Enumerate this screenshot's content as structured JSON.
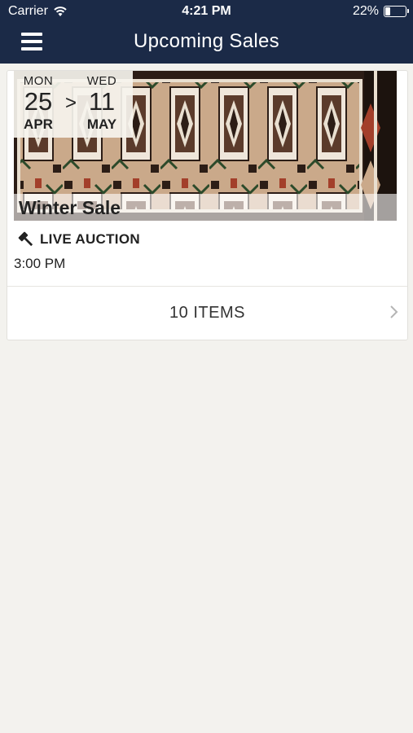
{
  "status_bar": {
    "carrier": "Carrier",
    "time": "4:21 PM",
    "battery": "22%",
    "battery_level": 0.22
  },
  "nav": {
    "title": "Upcoming Sales",
    "menu_icon": "hamburger-menu-icon"
  },
  "sale": {
    "start": {
      "dow": "MON",
      "day": "25",
      "month": "APR"
    },
    "separator": ">",
    "end": {
      "dow": "WED",
      "day": "11",
      "month": "MAY"
    },
    "title": "Winter Sale",
    "type": "LIVE AUCTION",
    "type_icon": "gavel-icon",
    "time": "3:00 PM",
    "items_label": "10 ITEMS"
  },
  "colors": {
    "nav_bg": "#1b2a47",
    "page_bg": "#f3f2ee",
    "rug_tan": "#c9a98a",
    "rug_dark": "#2c1d16"
  }
}
